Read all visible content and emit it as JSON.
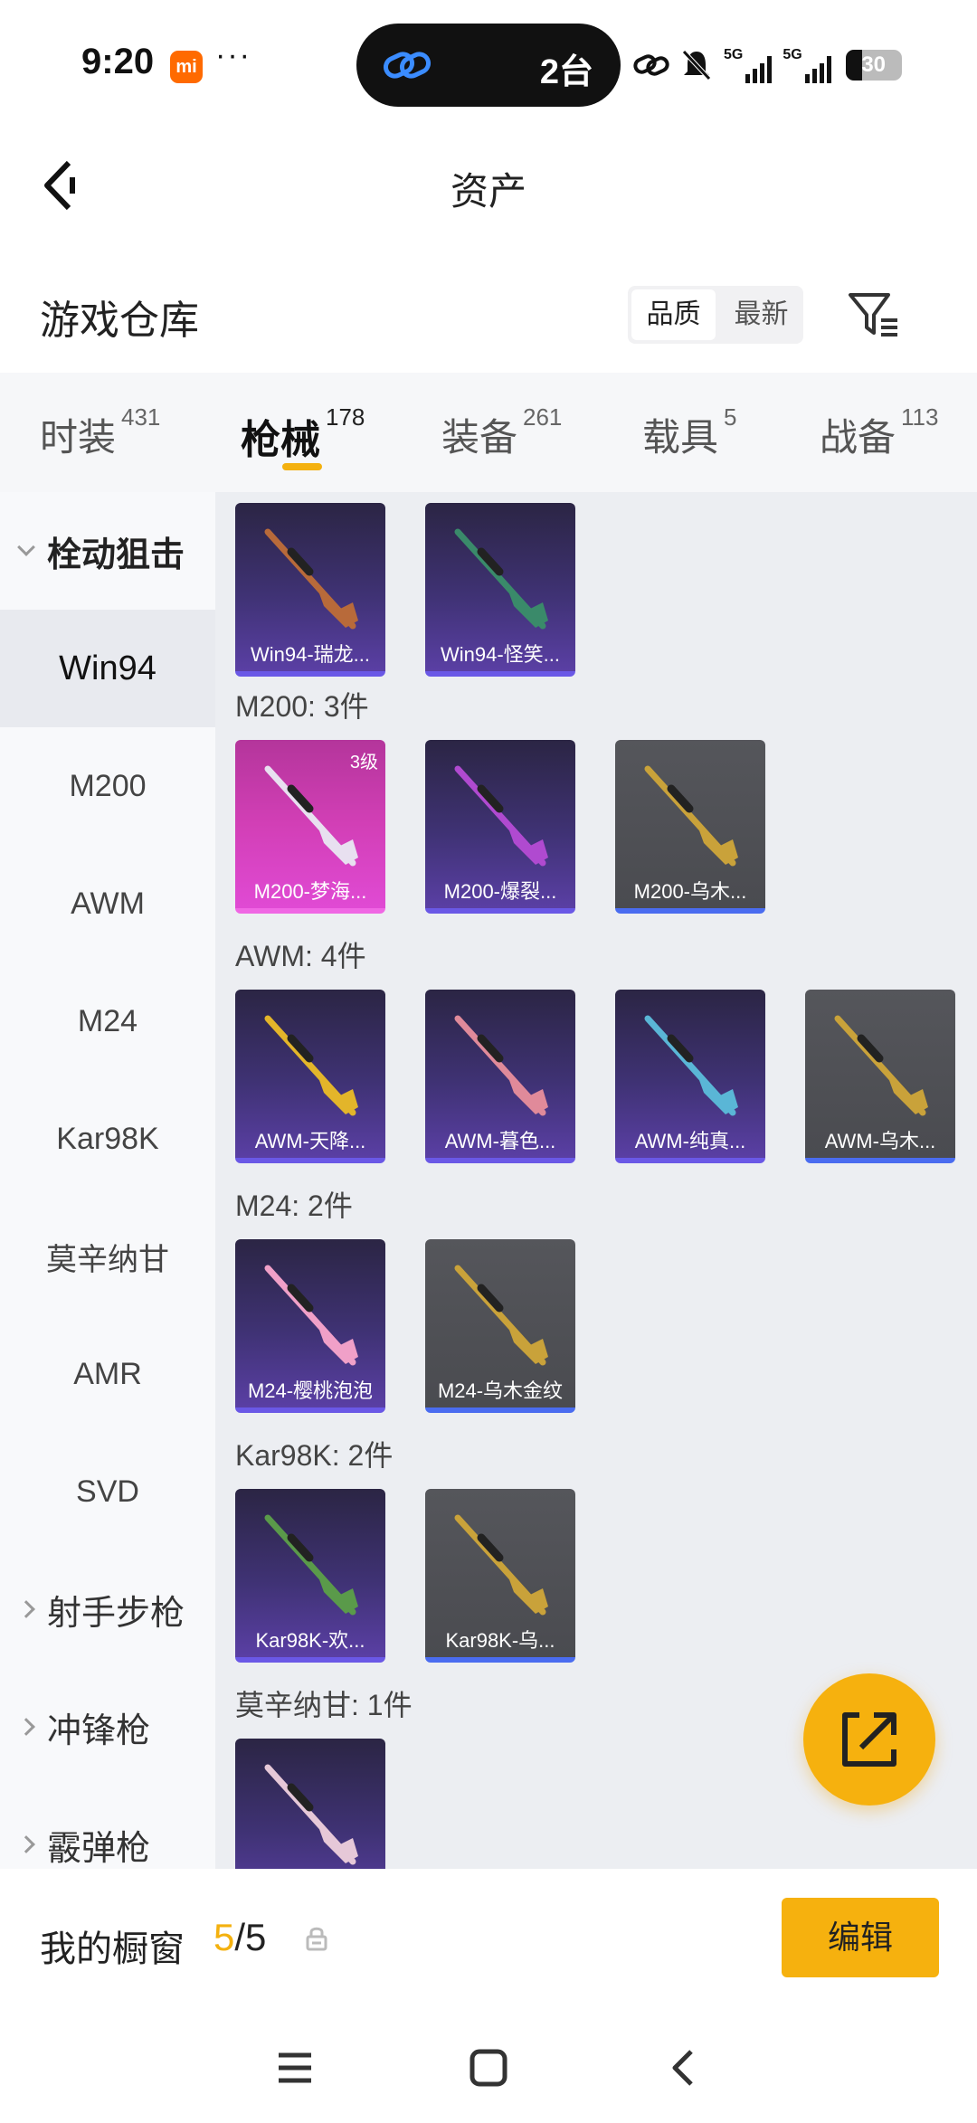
{
  "status_bar": {
    "time": "9:20",
    "mi_label": "mi",
    "dots": "···",
    "pill_text": "2台",
    "battery": "30",
    "net1": "5G",
    "net2": "5G"
  },
  "header": {
    "title": "资产"
  },
  "warehouse": {
    "title": "游戏仓库",
    "sort_options": [
      "品质",
      "最新"
    ],
    "sort_active": "品质"
  },
  "tabs": [
    {
      "label": "时装",
      "count": "431"
    },
    {
      "label": "枪械",
      "count": "178",
      "active": true
    },
    {
      "label": "装备",
      "count": "261"
    },
    {
      "label": "载具",
      "count": "5"
    },
    {
      "label": "战备",
      "count": "113"
    }
  ],
  "sidebar": {
    "items": [
      {
        "label": "栓动狙击",
        "type": "group-open"
      },
      {
        "label": "Win94",
        "type": "active"
      },
      {
        "label": "M200"
      },
      {
        "label": "AWM"
      },
      {
        "label": "M24"
      },
      {
        "label": "Kar98K"
      },
      {
        "label": "莫辛纳甘"
      },
      {
        "label": "AMR"
      },
      {
        "label": "SVD"
      },
      {
        "label": "射手步枪",
        "type": "group"
      },
      {
        "label": "冲锋枪",
        "type": "group"
      },
      {
        "label": "霰弹枪",
        "type": "group"
      }
    ]
  },
  "groups": [
    {
      "title": "",
      "cards": [
        {
          "name": "Win94-瑞龙...",
          "style": "purple",
          "gun": "#b86a3a"
        },
        {
          "name": "Win94-怪笑...",
          "style": "purple",
          "gun": "#3a8a6a"
        }
      ]
    },
    {
      "title": "M200: 3件",
      "cards": [
        {
          "name": "M200-梦海...",
          "style": "pink",
          "level": "3级",
          "gun": "#e8e0f0"
        },
        {
          "name": "M200-爆裂...",
          "style": "purple",
          "gun": "#b04ad0"
        },
        {
          "name": "M200-乌木...",
          "style": "gray",
          "gun": "#c9a23a"
        }
      ]
    },
    {
      "title": "AWM: 4件",
      "cards": [
        {
          "name": "AWM-天降...",
          "style": "purple",
          "gun": "#e3b52a"
        },
        {
          "name": "AWM-暮色...",
          "style": "purple",
          "gun": "#e08a9a"
        },
        {
          "name": "AWM-纯真...",
          "style": "purple",
          "gun": "#5ab6d6"
        },
        {
          "name": "AWM-乌木...",
          "style": "gray",
          "gun": "#c9a23a"
        }
      ]
    },
    {
      "title": "M24: 2件",
      "cards": [
        {
          "name": "M24-樱桃泡泡",
          "style": "purple",
          "gun": "#f0a0c8"
        },
        {
          "name": "M24-乌木金纹",
          "style": "gray",
          "gun": "#c9a23a"
        }
      ]
    },
    {
      "title": "Kar98K: 2件",
      "cards": [
        {
          "name": "Kar98K-欢...",
          "style": "purple",
          "gun": "#5a9a4a"
        },
        {
          "name": "Kar98K-乌...",
          "style": "gray",
          "gun": "#c9a23a"
        }
      ]
    },
    {
      "title": "莫辛纳甘: 1件",
      "cards": [
        {
          "name": "",
          "style": "purple",
          "gun": "#e6c8d8"
        }
      ]
    }
  ],
  "bottom": {
    "window_label": "我的橱窗",
    "current": "5",
    "total": "/5",
    "edit_label": "编辑"
  },
  "colors": {
    "accent": "#f6b10e",
    "rare_border": "#6a58e6",
    "epic_border": "#f067e4",
    "common_border": "#4a6cf0"
  }
}
